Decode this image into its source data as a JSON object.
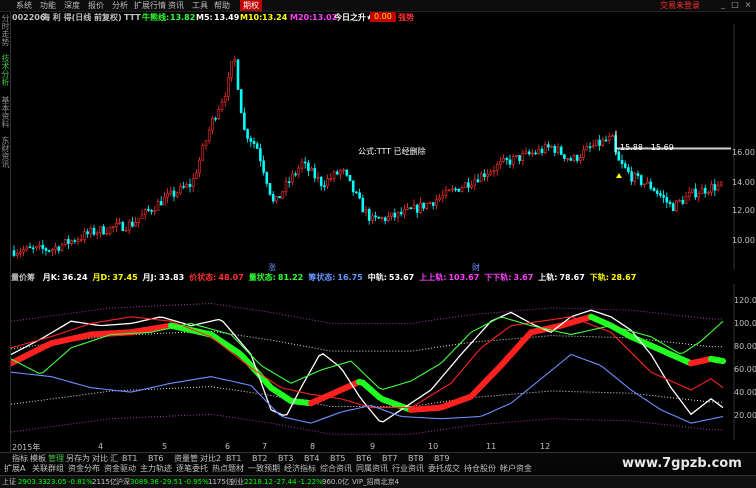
{
  "menu": {
    "items": [
      "系统",
      "功能",
      "深度",
      "报价",
      "分析",
      "扩展行情",
      "资讯",
      "工具",
      "帮助"
    ],
    "active": "期权",
    "window_buttons": [
      "_",
      "□",
      "×"
    ],
    "right_text": "交易未登录"
  },
  "sidebar": {
    "tabs": [
      "分时走势",
      "技术分析",
      "基本资料",
      "东财资讯"
    ],
    "active_index": 1
  },
  "header": {
    "code": "002206",
    "name": "海 利 得(日线 前复权)",
    "formula": "TTT",
    "ma_label": "牛熊线:",
    "ma_value": "13.82",
    "m5_label": "M5:",
    "m5_value": "13.49",
    "m10_label": "M10:",
    "m10_value": "13.24",
    "m20_label": "M20:",
    "m20_value": "13.02",
    "star_label": "今日之升★:",
    "star_value": "0.00",
    "alert": "强势",
    "status": "强势"
  },
  "chart_main": {
    "annotation": "公式:TTT 已经删除",
    "range_label": "15.88 - 15.69",
    "price_ticks": [
      "16.00",
      "14.00",
      "12.00",
      "10.00"
    ],
    "current_tick": "15.88",
    "marker_up": "涨",
    "marker_cai": "财"
  },
  "indicator": {
    "name": "量价筹",
    "items": [
      {
        "label": "月K:",
        "value": "36.24",
        "color": "#ffffff"
      },
      {
        "label": "月D:",
        "value": "37.45",
        "color": "#ffff00"
      },
      {
        "label": "月J:",
        "value": "33.83",
        "color": "#ffffff"
      },
      {
        "label": "价状态:",
        "value": "48.07",
        "color": "#ff3030"
      },
      {
        "label": "量状态:",
        "value": "81.22",
        "color": "#30ff30"
      },
      {
        "label": "筹状态:",
        "value": "16.75",
        "color": "#6495ff"
      },
      {
        "label": "中轨:",
        "value": "53.67",
        "color": "#ffffff"
      },
      {
        "label": "上上轨:",
        "value": "103.67",
        "color": "#ff40ff"
      },
      {
        "label": "下下轨:",
        "value": "3.67",
        "color": "#ff40ff"
      },
      {
        "label": "上轨:",
        "value": "78.67",
        "color": "#ffffff"
      },
      {
        "label": "下轨:",
        "value": "28.67",
        "color": "#ffff00"
      }
    ],
    "ticks": [
      "120.00",
      "100.00",
      "80.00",
      "60.00",
      "40.00",
      "20.00"
    ]
  },
  "x_axis": {
    "labels": [
      "2015年",
      "4",
      "5",
      "6",
      "7",
      "8",
      "9",
      "10",
      "11",
      "12"
    ]
  },
  "bottom_tabs": {
    "row1": [
      "指标",
      "模板",
      "管理",
      "另存为",
      "对比",
      "汇",
      "BT1",
      "BT6",
      "资量管",
      "对比2",
      "BT1",
      "BT2",
      "BT3",
      "BT4",
      "BT5",
      "BT6",
      "BT7",
      "BT8",
      "BT9"
    ],
    "row1_active": 2,
    "row2": [
      "扩展A",
      "关联群组",
      "资金分布",
      "资金驱动",
      "主力轨迹",
      "逐笔委托",
      "热点题材",
      "一致预期",
      "经济指标",
      "综合资讯",
      "同属资讯",
      "行业资讯",
      "委托成交",
      "持仓股份",
      "帐户资金"
    ]
  },
  "statusbar": {
    "items": [
      {
        "text": "上证",
        "color": "#c0c0c0"
      },
      {
        "text": "2903.33",
        "color": "#00ff00"
      },
      {
        "text": "-23.05",
        "color": "#00ff00"
      },
      {
        "text": "-0.81%",
        "color": "#00ff00"
      },
      {
        "text": "2115亿",
        "color": "#c0c0c0"
      },
      {
        "text": "沪深",
        "color": "#c0c0c0"
      },
      {
        "text": "3089.36",
        "color": "#00ff00"
      },
      {
        "text": "-29.51",
        "color": "#00ff00"
      },
      {
        "text": "-0.95%",
        "color": "#00ff00"
      },
      {
        "text": "1175亿",
        "color": "#c0c0c0"
      },
      {
        "text": "创业",
        "color": "#c0c0c0"
      },
      {
        "text": "2218.12",
        "color": "#00ff00"
      },
      {
        "text": "-27.44",
        "color": "#00ff00"
      },
      {
        "text": "-1.22%",
        "color": "#00ff00"
      },
      {
        "text": "960.0亿",
        "color": "#c0c0c0"
      },
      {
        "text": "VIP_招商北京4",
        "color": "#c0c0c0"
      }
    ]
  },
  "watermark": "www.7gpzb.com"
}
